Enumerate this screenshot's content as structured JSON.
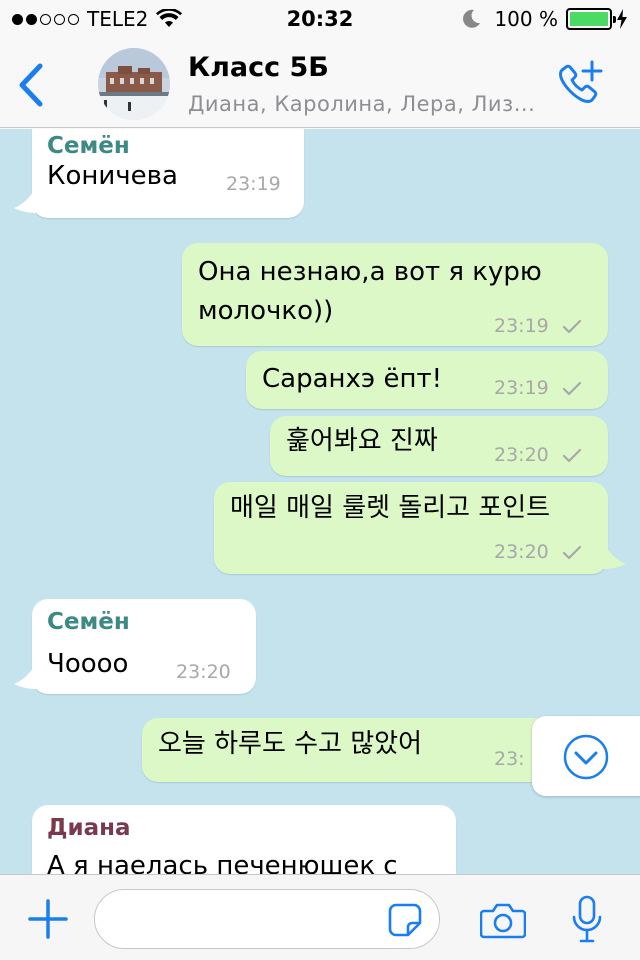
{
  "status_bar": {
    "carrier": "TELE2",
    "time": "20:32",
    "battery_percent": "100 %"
  },
  "header": {
    "title": "Класс 5Б",
    "subtitle": "Диана, Каролина, Лера, Лиз..."
  },
  "colors": {
    "accent": "#1a7ef0",
    "incoming_bubble": "#ffffff",
    "outgoing_bubble": "#dcf8c6",
    "chat_background": "#c4e3ec",
    "sender_semyon": "#3c8a83",
    "sender_diana": "#7a3a4e"
  },
  "messages": [
    {
      "direction": "in",
      "sender": "Семён",
      "text": "Коничева",
      "time": "23:19"
    },
    {
      "direction": "out",
      "lines": [
        "Она незнаю,а вот я курю",
        "молочко))"
      ],
      "time": "23:19",
      "status": "sent"
    },
    {
      "direction": "out",
      "text": "Саранхэ ёпт!",
      "time": "23:19",
      "status": "sent"
    },
    {
      "direction": "out",
      "text": "훑어봐요 진짜",
      "time": "23:20",
      "status": "sent"
    },
    {
      "direction": "out",
      "text": "매일 매일 룰렛 돌리고 포인트",
      "time": "23:20",
      "status": "sent"
    },
    {
      "direction": "in",
      "sender": "Семён",
      "text": "Чоооо",
      "time": "23:20"
    },
    {
      "direction": "out",
      "text": "오늘 하루도 수고 많았어",
      "time": "23:"
    },
    {
      "direction": "in",
      "sender": "Диана",
      "text": "А я наелась печенюшек с"
    }
  ],
  "composer": {
    "placeholder": ""
  },
  "icons": {
    "back": "chevron-left-icon",
    "call": "phone-add-icon",
    "scroll_down": "chevron-down-circle-icon",
    "attach": "plus-icon",
    "sticker": "sticker-icon",
    "camera": "camera-icon",
    "mic": "microphone-icon"
  }
}
